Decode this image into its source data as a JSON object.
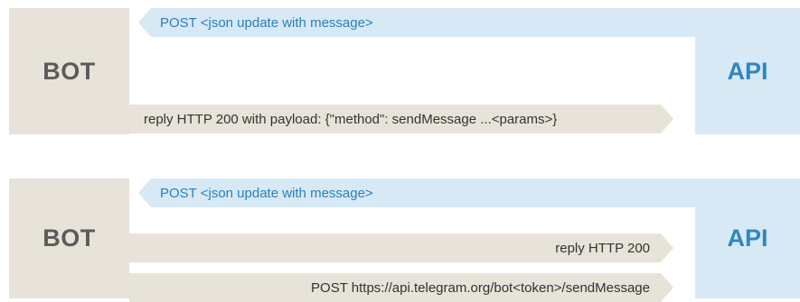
{
  "panels": [
    {
      "bot_label": "BOT",
      "api_label": "API",
      "arrows": [
        {
          "direction": "api-to-bot",
          "text": "POST <json update with message>"
        },
        {
          "direction": "bot-to-api",
          "text": "reply HTTP 200 with payload: {\"method\": sendMessage ...<params>}"
        }
      ]
    },
    {
      "bot_label": "BOT",
      "api_label": "API",
      "arrows": [
        {
          "direction": "api-to-bot",
          "text": "POST <json update with message>"
        },
        {
          "direction": "bot-to-api",
          "text": "reply HTTP 200"
        },
        {
          "direction": "bot-to-api",
          "text": "POST https://api.telegram.org/bot<token>/sendMessage"
        }
      ]
    }
  ],
  "colors": {
    "bot_background": "#e8e3d9",
    "api_background": "#d7e9f5",
    "bot_text": "#5b5b5b",
    "api_text": "#2f87c2",
    "incoming_arrow_text": "#2a7fb8",
    "outgoing_arrow_text": "#333333"
  }
}
